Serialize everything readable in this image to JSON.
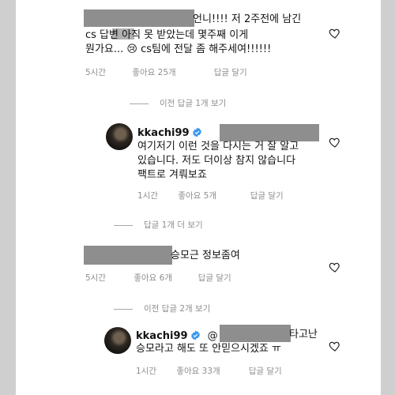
{
  "comments": [
    {
      "id": "c1",
      "lines": [
        "언니!!!! 저 2주전에 남긴",
        "cs 답변 아직 못 받았는데 몇주째 이게",
        "뭔가요... 😢 cs팀에 전달 좀 해주세여!!!!!!"
      ],
      "time": "5시간",
      "likes": "좋아요 25개",
      "reply": "답글 달기"
    },
    {
      "id": "c2",
      "username": "kkachi99",
      "lines": [
        "여기저기 이런 것을 다시는 거 잘 알고",
        "있습니다. 저도 더이상 참지 않습니다",
        "팩트로 겨뤄보죠"
      ],
      "time": "1시간",
      "likes": "좋아요 5개",
      "reply": "답글 달기"
    },
    {
      "id": "c3",
      "lines": [
        "승모근 정보좀여"
      ],
      "time": "5시간",
      "likes": "좋아요 6개",
      "reply": "답글 달기"
    },
    {
      "id": "c4",
      "username": "kkachi99",
      "mention_symbol": "@",
      "line1_suffix": "타고난",
      "line2": "승모라고 해도 또 안믿으시겠죠 ㅠ",
      "time": "1시간",
      "likes": "좋아요 33개",
      "reply": "답글 달기"
    }
  ],
  "view_replies": [
    "이전 답글 1개 보기",
    "답글 1개 더 보기",
    "이전 답글 2개 보기"
  ],
  "colors": {
    "redaction": "#8e8e8e",
    "verified": "#3897f0",
    "meta_text": "#8e8e8e"
  }
}
